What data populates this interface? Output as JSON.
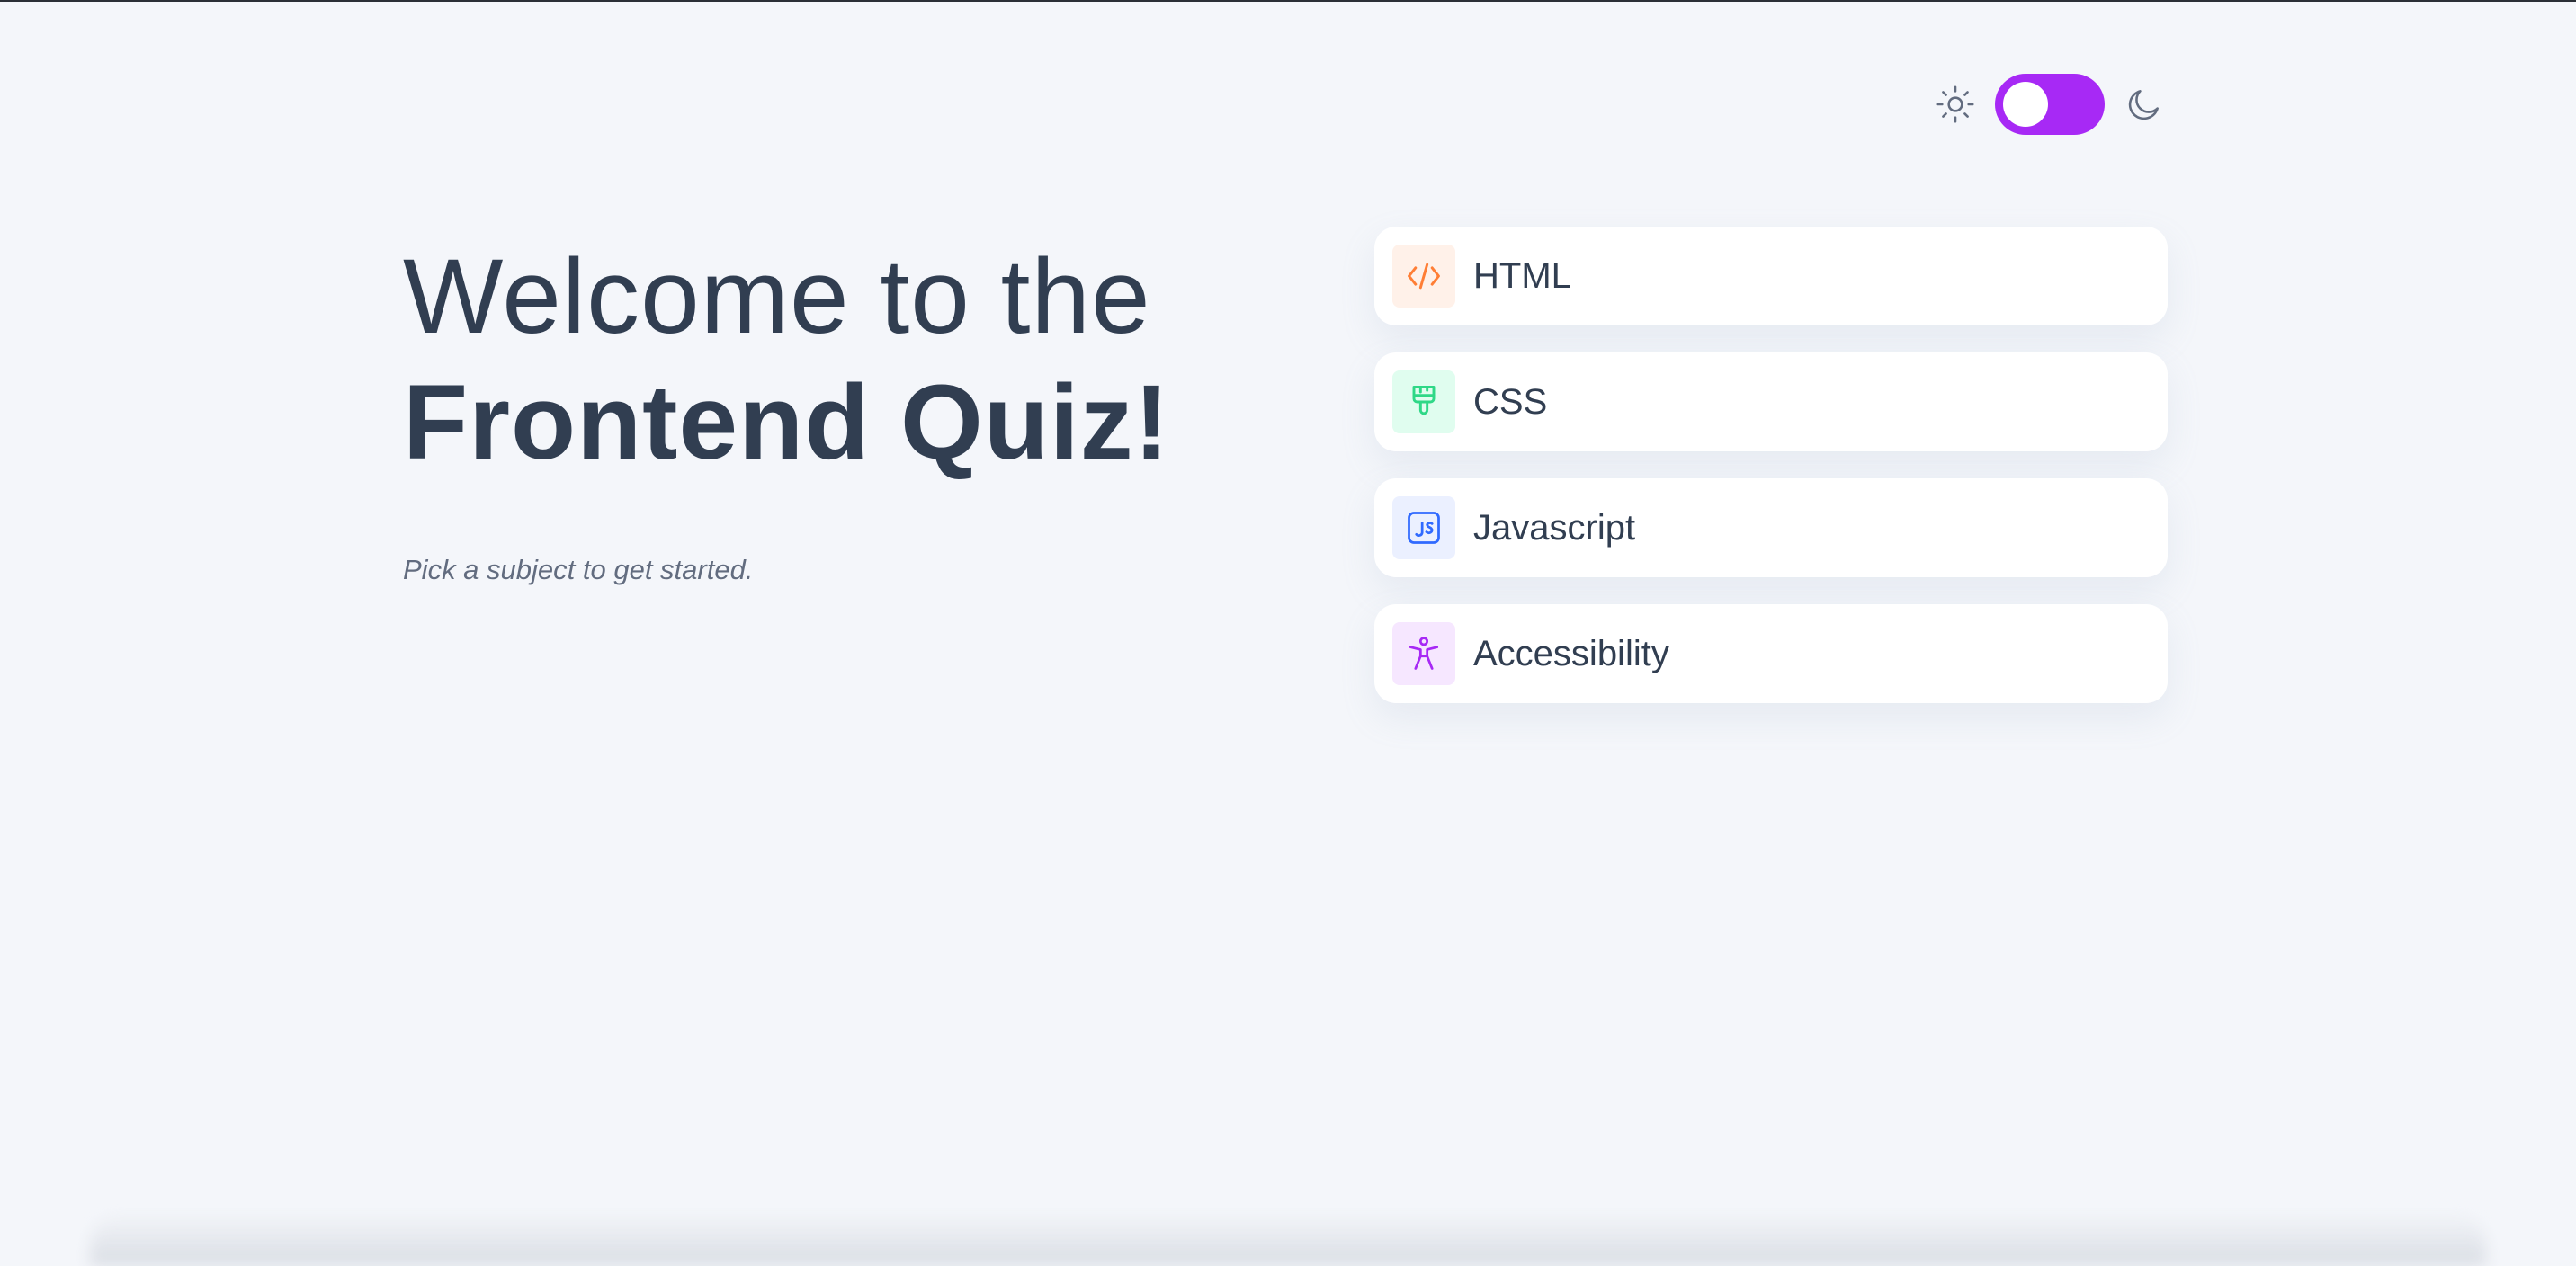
{
  "theme_toggle": {
    "light_icon": "sun-icon",
    "dark_icon": "moon-icon",
    "accent": "#a729f5",
    "state": "light"
  },
  "hero": {
    "line1": "Welcome to the",
    "line2": "Frontend Quiz!",
    "subtitle": "Pick a subject to get started."
  },
  "subjects": [
    {
      "label": "HTML",
      "icon": "html-code-icon",
      "icon_bg": "#fff1e9",
      "icon_color": "#ff7e35"
    },
    {
      "label": "CSS",
      "icon": "css-brush-icon",
      "icon_bg": "#e0fdef",
      "icon_color": "#2fd887"
    },
    {
      "label": "Javascript",
      "icon": "javascript-js-icon",
      "icon_bg": "#ebf0ff",
      "icon_color": "#306aff"
    },
    {
      "label": "Accessibility",
      "icon": "accessibility-person-icon",
      "icon_bg": "#f6e7ff",
      "icon_color": "#a729f5"
    }
  ],
  "colors": {
    "background": "#f4f6fa",
    "text_dark": "#313e51",
    "text_muted": "#626c7f",
    "card": "#ffffff"
  }
}
